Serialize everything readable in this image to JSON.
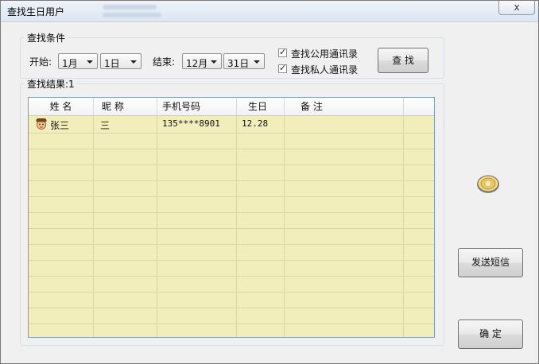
{
  "window": {
    "title": "查找生日用户",
    "close_glyph": "x"
  },
  "search_group": {
    "legend": "查找条件",
    "start_label": "开始:",
    "start_month": "1月",
    "start_day": "1日",
    "end_label": "结束:",
    "end_month": "12月",
    "end_day": "31日",
    "public_contacts": {
      "label": "查找公用通讯录",
      "checked": true
    },
    "private_contacts": {
      "label": "查找私人通讯录",
      "checked": true
    },
    "search_button": "查 找"
  },
  "results_group": {
    "legend": "查找结果:1"
  },
  "table": {
    "columns": [
      "姓 名",
      "昵 称",
      "手机号码",
      "生日",
      "备 注"
    ],
    "rows": [
      {
        "name": "张三",
        "nickname": "三",
        "phone": "135****8901",
        "birthday": "12.28",
        "note": ""
      }
    ]
  },
  "buttons": {
    "send_sms": "发送短信",
    "ok": "确 定"
  },
  "colors": {
    "grid_bg": "#f2eebc",
    "row_line": "#dcd6a0"
  }
}
